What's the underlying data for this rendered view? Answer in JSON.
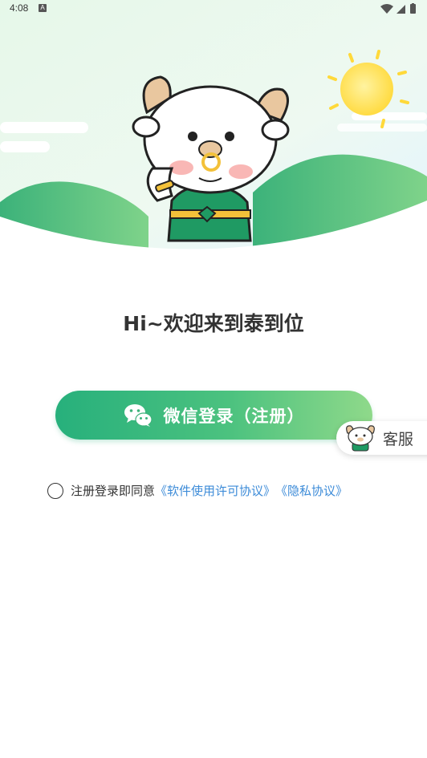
{
  "status_bar": {
    "time": "4:08",
    "notification_glyph": "A",
    "icons": [
      "wifi-icon",
      "signal-icon",
      "battery-icon"
    ]
  },
  "welcome_title": "Hi~欢迎来到泰到位",
  "login": {
    "wechat_label": "微信登录（注册）",
    "icon": "wechat-icon"
  },
  "customer_service": {
    "label": "客服",
    "icon": "mascot-avatar"
  },
  "agreement": {
    "prefix": "注册登录即同意",
    "license_link": "《软件使用许可协议》",
    "privacy_link": "《隐私协议》",
    "checked": false
  },
  "colors": {
    "primary_green": "#27b07c",
    "light_green": "#8fd98a",
    "link_blue": "#3c8bd8",
    "sun_yellow": "#ffe15a"
  }
}
